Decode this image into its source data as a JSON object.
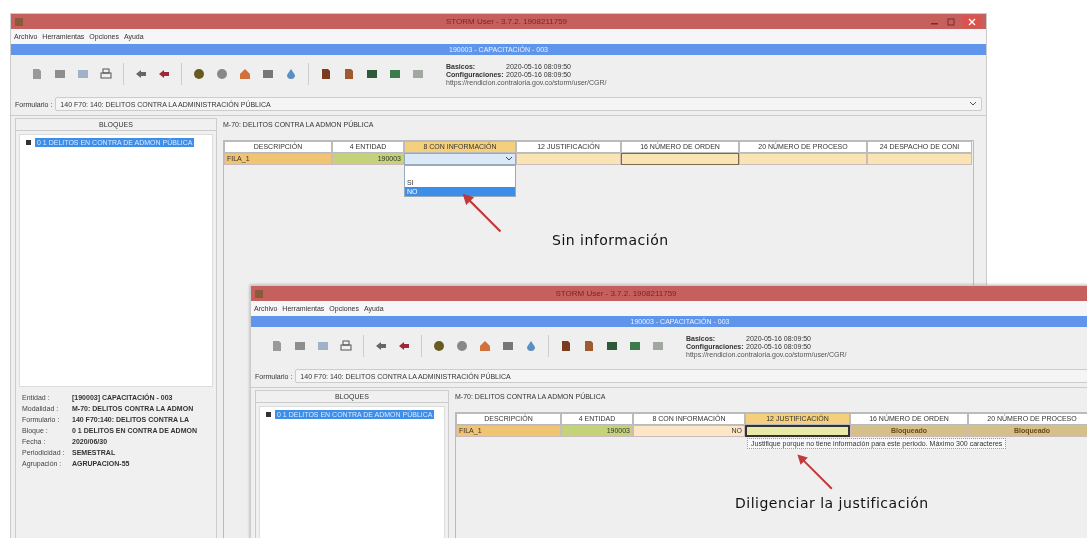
{
  "windows": [
    {
      "title": "STORM User - 3.7.2. 1908211759",
      "controls": true,
      "menu": [
        "Archivo",
        "Herramientas",
        "Opciones",
        "Ayuda"
      ],
      "banner": "190003 - CAPACITACIÓN - 003",
      "info": [
        {
          "label": "Basicos:",
          "value": "2020-05-16 08:09:50"
        },
        {
          "label": "Configuraciones:",
          "value": "2020-05-16 08:09:50"
        }
      ],
      "url": "https://rendicion.contraloria.gov.co/storm/user/CGR/",
      "form_label": "Formulario :",
      "form_value": "140 F70: 140: DELITOS CONTRA LA ADMINISTRACIÓN PÚBLICA",
      "blocks_header": "BLOQUES",
      "tree": [
        {
          "label": "0 1 DELITOS EN CONTRA DE ADMON PÚBLICA",
          "selected": true
        }
      ],
      "module_title": "M-70: DELITOS CONTRA LA ADMON PÚBLICA",
      "columns": [
        {
          "label": "DESCRIPCIÓN",
          "selected": false
        },
        {
          "label": "4 ENTIDAD",
          "selected": false
        },
        {
          "label": "8 CON INFORMACIÓN",
          "selected": true
        },
        {
          "label": "12 JUSTIFICACIÓN",
          "selected": false
        },
        {
          "label": "16 NÚMERO DE ORDEN",
          "selected": false
        },
        {
          "label": "20 NÚMERO DE PROCESO",
          "selected": false
        },
        {
          "label": "24 DESPACHO DE CONI",
          "selected": false
        }
      ],
      "row": [
        {
          "kind": "label",
          "value": "FILA_1"
        },
        {
          "kind": "number",
          "value": "190003"
        },
        {
          "kind": "combo",
          "options": [
            {
              "label": "SI",
              "selected": false
            },
            {
              "label": "NO",
              "selected": true
            }
          ],
          "annotation": "Sin información"
        },
        {
          "kind": "empty"
        },
        {
          "kind": "focus"
        },
        {
          "kind": "empty"
        },
        {
          "kind": "empty"
        }
      ],
      "details": [
        {
          "label": "Entidad :",
          "value": "[190003] CAPACITACIÓN - 003"
        },
        {
          "label": "Modalidad :",
          "value": "M-70: DELITOS CONTRA LA ADMON"
        },
        {
          "label": "Formulario :",
          "value": "140 F70:140: DELITOS CONTRA LA"
        },
        {
          "label": "Bloque :",
          "value": "0 1 DELITOS EN CONTRA DE ADMON"
        },
        {
          "label": "Fecha :",
          "value": "2020/06/30"
        },
        {
          "label": "Periodicidad :",
          "value": "SEMESTRAL"
        },
        {
          "label": "Agrupación :",
          "value": "AGRUPACION-55"
        }
      ]
    },
    {
      "title": "STORM User - 3.7.2. 1908211759",
      "controls": false,
      "menu": [
        "Archivo",
        "Herramientas",
        "Opciones",
        "Ayuda"
      ],
      "banner": "190003 - CAPACITACIÓN - 003",
      "info": [
        {
          "label": "Basicos:",
          "value": "2020-05-16 08:09:50"
        },
        {
          "label": "Configuraciones:",
          "value": "2020-05-16 08:09:50"
        }
      ],
      "url": "https://rendicion.contraloria.gov.co/storm/user/CGR/",
      "form_label": "Formulario :",
      "form_value": "140 F70: 140: DELITOS CONTRA LA ADMINISTRACIÓN PÚBLICA",
      "blocks_header": "BLOQUES",
      "tree": [
        {
          "label": "0 1 DELITOS EN CONTRA DE ADMON PÚBLICA",
          "selected": true
        }
      ],
      "module_title": "M-70: DELITOS CONTRA LA ADMON PÚBLICA",
      "columns": [
        {
          "label": "DESCRIPCIÓN",
          "selected": false
        },
        {
          "label": "4 ENTIDAD",
          "selected": false
        },
        {
          "label": "8 CON INFORMACIÓN",
          "selected": false
        },
        {
          "label": "12 JUSTIFICACIÓN",
          "selected": true
        },
        {
          "label": "16 NÚMERO DE ORDEN",
          "selected": false
        },
        {
          "label": "20 NÚMERO DE PROCESO",
          "selected": false
        }
      ],
      "row": [
        {
          "kind": "label",
          "value": "FILA_1"
        },
        {
          "kind": "number",
          "value": "190003"
        },
        {
          "kind": "value",
          "value": "NO"
        },
        {
          "kind": "edit",
          "tooltip": "Justifique porque no tiene información para este periodo. Máximo 300 caracteres",
          "annotation": "Diligenciar la justificación"
        },
        {
          "kind": "locked",
          "value": "Bloqueado"
        },
        {
          "kind": "locked",
          "value": "Bloqueado"
        }
      ]
    }
  ]
}
